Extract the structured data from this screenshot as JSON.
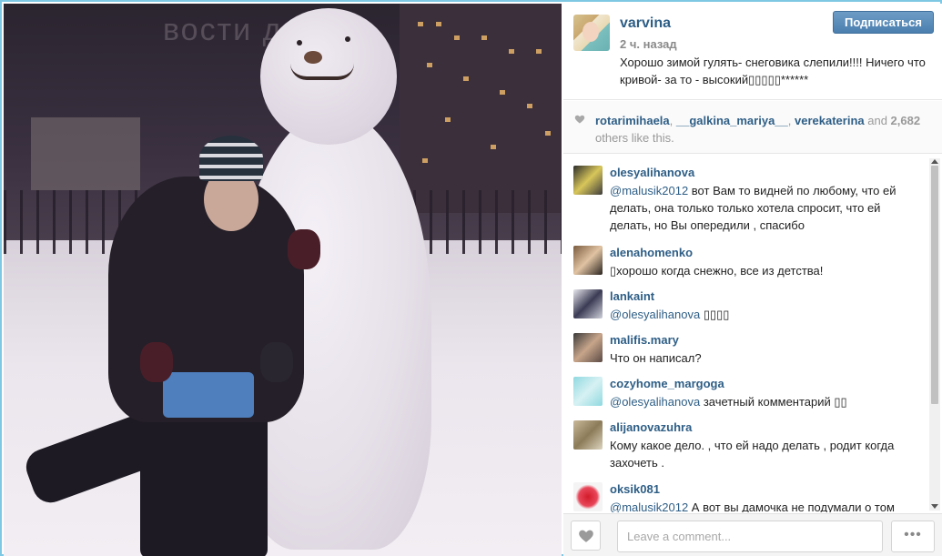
{
  "post": {
    "username": "varvina",
    "time": "2 ч. назад",
    "follow_label": "Подписаться",
    "caption": "Хорошо зимой гулять- снеговика слепили!!!! Ничего что кривой- за то - высокий▯▯▯▯▯******"
  },
  "photo": {
    "watermark": "вости д"
  },
  "likes": {
    "user1": "rotarimihaela",
    "sep1": ", ",
    "user2": "__galkina_mariya__",
    "sep2": ", ",
    "user3": "verekaterina",
    "and": " and ",
    "count": "2,682",
    "tail": " others like this."
  },
  "comments": [
    {
      "user": "olesyalihanova",
      "mention": "@malusik2012",
      "text": " вот Вам то видней по любому, что ей делать, она только только хотела спросит, что ей делать, но Вы опередили , спасибо",
      "avatar": "avatar-1"
    },
    {
      "user": "alenahomenko",
      "mention": "",
      "text": "▯хорошо когда снежно, все из детства!",
      "avatar": "avatar-2"
    },
    {
      "user": "lankaint",
      "mention": "@olesyalihanova",
      "text": " ▯▯▯▯",
      "avatar": "avatar-3"
    },
    {
      "user": "malifis.mary",
      "mention": "",
      "text": "Что он написал?",
      "avatar": "avatar-4"
    },
    {
      "user": "cozyhome_margoga",
      "mention": "@olesyalihanova",
      "text": " зачетный комментарий ▯▯",
      "avatar": "avatar-5"
    },
    {
      "user": "alijanovazuhra",
      "mention": "",
      "text": "Кому какое дело. , что ей надо делать , родит когда захочеть .",
      "avatar": "avatar-6"
    },
    {
      "user": "oksik081",
      "mention": "@malusik2012",
      "text": " А вот вы дамочка не подумали о том",
      "avatar": "avatar-7"
    }
  ],
  "footer": {
    "comment_placeholder": "Leave a comment...",
    "more_label": "•••"
  },
  "colors": {
    "link_blue": "#2e5e86",
    "follow_button": "#4b7fae",
    "frame_border": "#7fc8e4"
  }
}
